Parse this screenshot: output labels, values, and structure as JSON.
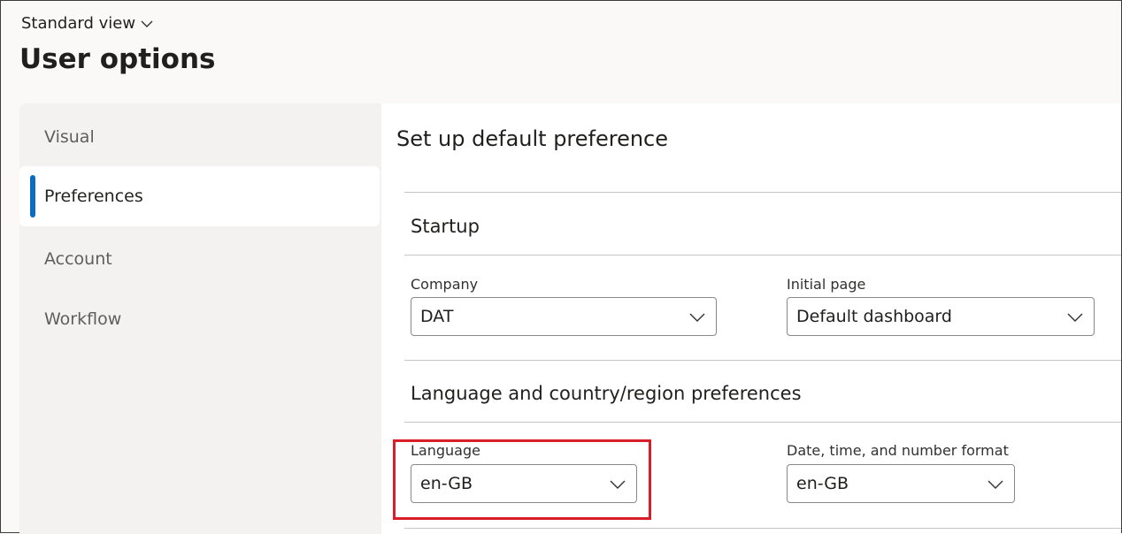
{
  "header": {
    "view_label": "Standard view",
    "title": "User options"
  },
  "nav": {
    "items": [
      {
        "label": "Visual"
      },
      {
        "label": "Preferences",
        "active": true
      },
      {
        "label": "Account"
      },
      {
        "label": "Workflow"
      }
    ]
  },
  "main": {
    "heading": "Set up default preference",
    "startup": {
      "title": "Startup",
      "company": {
        "label": "Company",
        "value": "DAT"
      },
      "initial_page": {
        "label": "Initial page",
        "value": "Default dashboard"
      }
    },
    "language_section": {
      "title": "Language and country/region preferences",
      "language": {
        "label": "Language",
        "value": "en-GB"
      },
      "format": {
        "label": "Date, time, and number format",
        "value": "en-GB"
      }
    }
  },
  "colors": {
    "accent": "#0f6cbd",
    "highlight": "#d81e28"
  }
}
